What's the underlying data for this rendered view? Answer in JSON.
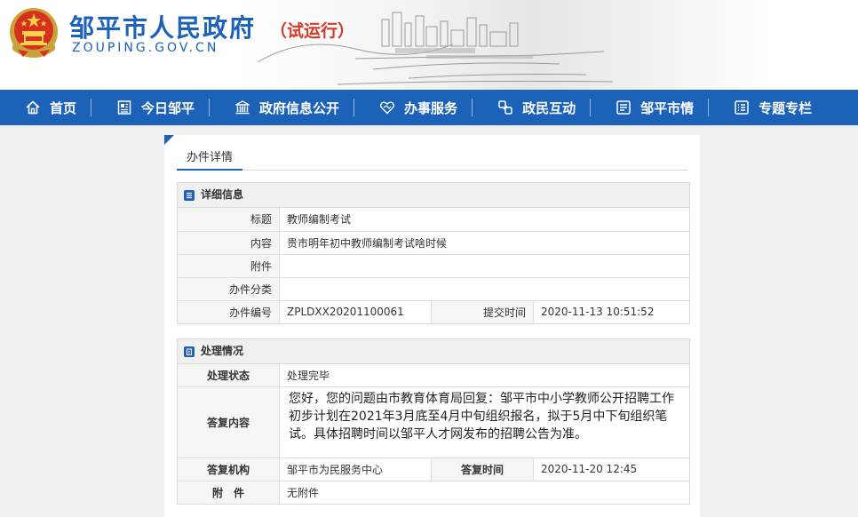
{
  "site": {
    "title": "邹平市人民政府",
    "subtitle": "（试运行）",
    "domain": "ZOUPING.GOV.CN",
    "brand_blue": "#1c62b9",
    "accent_red": "#d43a2a"
  },
  "nav": [
    {
      "label": "首页",
      "icon": "home-icon"
    },
    {
      "label": "今日邹平",
      "icon": "newspaper-icon"
    },
    {
      "label": "政府信息公开",
      "icon": "government-building-icon"
    },
    {
      "label": "办事服务",
      "icon": "handshake-heart-icon"
    },
    {
      "label": "政民互动",
      "icon": "link-icon"
    },
    {
      "label": "邹平市情",
      "icon": "document-icon"
    },
    {
      "label": "专题专栏",
      "icon": "list-icon"
    }
  ],
  "tab": {
    "label": "办件详情"
  },
  "detail": {
    "heading": "详细信息",
    "rows": [
      {
        "label": "标题",
        "value": "教师编制考试"
      },
      {
        "label": "内容",
        "value": "贵市明年初中教师编制考试啥时候"
      },
      {
        "label": "附件",
        "value": ""
      },
      {
        "label": "办件分类",
        "value": ""
      }
    ],
    "number_label": "办件编号",
    "number_value": "ZPLDXX20201100061",
    "submit_label": "提交时间",
    "submit_value": "2020-11-13 10:51:52"
  },
  "handling": {
    "heading": "处理情况",
    "status_label": "处理状态",
    "status_value": "处理完毕",
    "answer_label": "答复内容",
    "answer_value": "您好，您的问题由市教育体育局回复：邹平市中小学教师公开招聘工作初步计划在2021年3月底至4月中旬组织报名，拟于5月中下旬组织笔试。具体招聘时间以邹平人才网发布的招聘公告为准。",
    "org_label": "答复机构",
    "org_value": "邹平市为民服务中心",
    "time_label": "答复时间",
    "time_value": "2020-11-20 12:45",
    "attach_label": "附　件",
    "attach_value": "无附件"
  }
}
